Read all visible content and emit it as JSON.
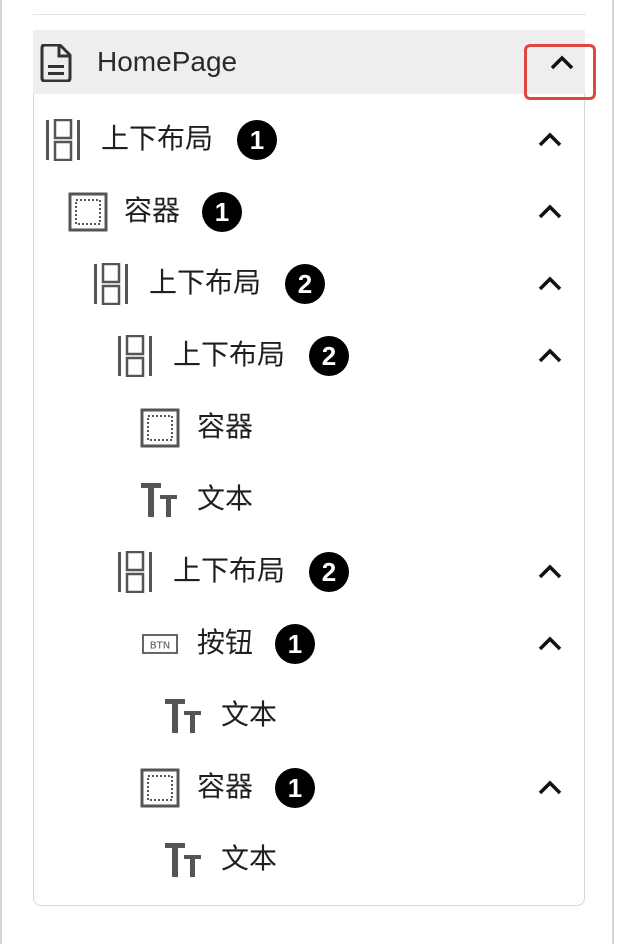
{
  "header": {
    "title": "HomePage",
    "icon": "document-icon"
  },
  "tree": [
    {
      "label": "上下布局",
      "icon": "vertical-layout-icon",
      "badge": "1",
      "expanded": true
    },
    {
      "label": "容器",
      "icon": "container-icon",
      "badge": "1",
      "expanded": true
    },
    {
      "label": "上下布局",
      "icon": "vertical-layout-icon",
      "badge": "2",
      "expanded": true
    },
    {
      "label": "上下布局",
      "icon": "vertical-layout-icon",
      "badge": "2",
      "expanded": true
    },
    {
      "label": "容器",
      "icon": "container-icon"
    },
    {
      "label": "文本",
      "icon": "text-icon"
    },
    {
      "label": "上下布局",
      "icon": "vertical-layout-icon",
      "badge": "2",
      "expanded": true
    },
    {
      "label": "按钮",
      "icon": "button-icon",
      "badge": "1",
      "expanded": true
    },
    {
      "label": "文本",
      "icon": "text-icon"
    },
    {
      "label": "容器",
      "icon": "container-icon",
      "badge": "1",
      "expanded": true
    },
    {
      "label": "文本",
      "icon": "text-icon"
    }
  ],
  "button_icon_text": "BTN",
  "colors": {
    "highlight": "#e0473d",
    "header_bg": "#eeeeee",
    "badge_bg": "#000000"
  }
}
